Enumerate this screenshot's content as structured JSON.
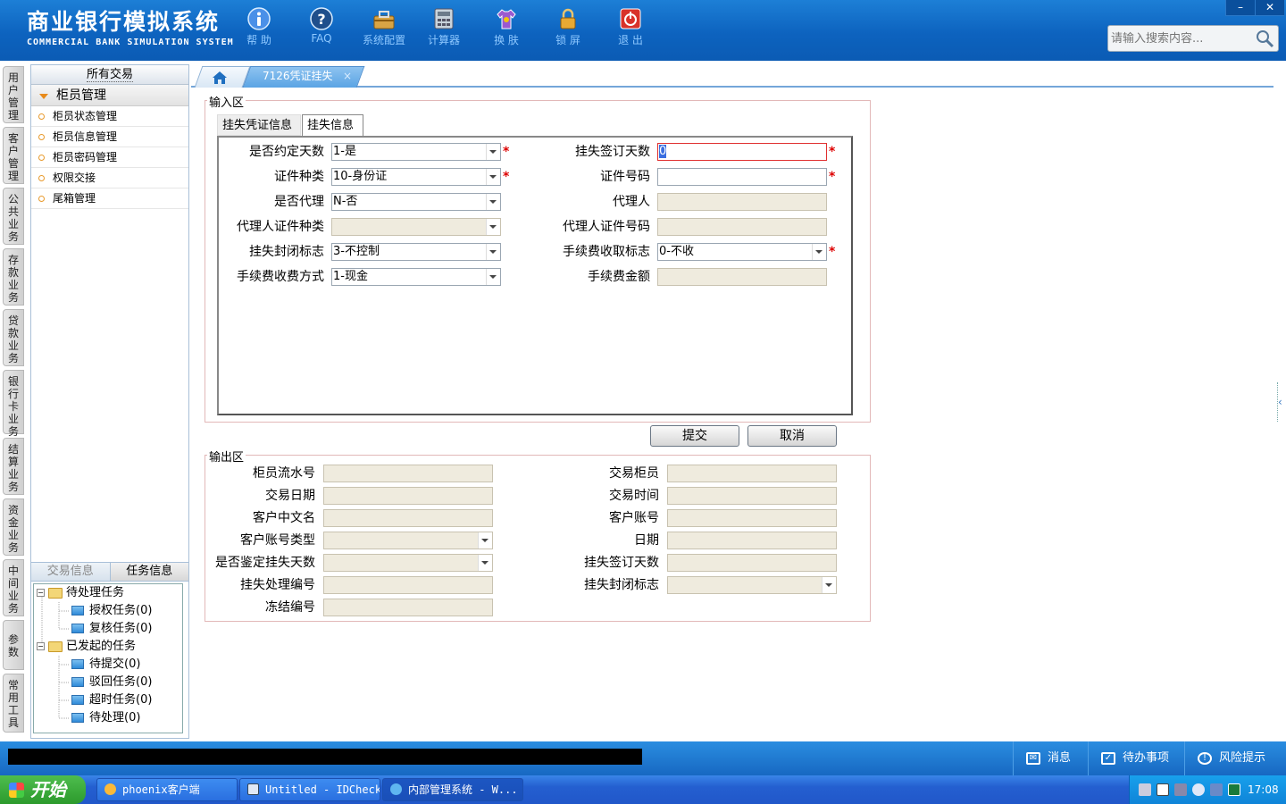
{
  "app": {
    "title_cn": "商业银行模拟系统",
    "title_en": "COMMERCIAL BANK SIMULATION SYSTEM",
    "toolbar": [
      {
        "label": "帮 助",
        "icon": "help-info-icon"
      },
      {
        "label": "FAQ",
        "icon": "faq-question-icon"
      },
      {
        "label": "系统配置",
        "icon": "toolbox-icon"
      },
      {
        "label": "计算器",
        "icon": "calculator-icon"
      },
      {
        "label": "换 肤",
        "icon": "shirt-icon"
      },
      {
        "label": "锁 屏",
        "icon": "lock-icon"
      },
      {
        "label": "退 出",
        "icon": "power-icon"
      }
    ],
    "window_minimize": "–",
    "window_close": "✕",
    "search_placeholder": "请输入搜索内容..."
  },
  "vtabs": [
    "用户管理",
    "客户管理",
    "公共业务",
    "存款业务",
    "贷款业务",
    "银行卡业务",
    "结算业务",
    "资金业务",
    "中间业务",
    "参数",
    "常用工具"
  ],
  "sidebar": {
    "header": "所有交易",
    "group": "柜员管理",
    "items": [
      "柜员状态管理",
      "柜员信息管理",
      "柜员密码管理",
      "权限交接",
      "尾箱管理"
    ],
    "bottom_tabs": [
      "交易信息",
      "任务信息"
    ],
    "tree": {
      "pending_root": "待处理任务",
      "pending_children": [
        "授权任务(0)",
        "复核任务(0)"
      ],
      "initiated_root": "已发起的任务",
      "initiated_children": [
        "待提交(0)",
        "驳回任务(0)",
        "超时任务(0)",
        "待处理(0)"
      ]
    }
  },
  "main_tab": {
    "label": "7126凭证挂失",
    "close": "×"
  },
  "input_area": {
    "legend": "输入区",
    "tabs": [
      "挂失凭证信息",
      "挂失信息"
    ],
    "fields": {
      "agreed_days_label": "是否约定天数",
      "agreed_days_value": "1-是",
      "signed_days_label": "挂失签订天数",
      "signed_days_value": "0",
      "id_type_label": "证件种类",
      "id_type_value": "10-身份证",
      "id_no_label": "证件号码",
      "id_no_value": "",
      "is_agent_label": "是否代理",
      "is_agent_value": "N-否",
      "agent_label": "代理人",
      "agent_value": "",
      "agent_id_type_label": "代理人证件种类",
      "agent_id_type_value": "",
      "agent_id_no_label": "代理人证件号码",
      "agent_id_no_value": "",
      "seal_flag_label": "挂失封闭标志",
      "seal_flag_value": "3-不控制",
      "fee_flag_label": "手续费收取标志",
      "fee_flag_value": "0-不收",
      "fee_method_label": "手续费收费方式",
      "fee_method_value": "1-现金",
      "fee_amount_label": "手续费金额",
      "fee_amount_value": ""
    },
    "required_mark": "*",
    "submit": "提交",
    "cancel": "取消"
  },
  "output_area": {
    "legend": "输出区",
    "fields": {
      "teller_seq": "柜员流水号",
      "trade_teller": "交易柜员",
      "trade_date": "交易日期",
      "trade_time": "交易时间",
      "cust_name": "客户中文名",
      "cust_account": "客户账号",
      "account_type": "客户账号类型",
      "date": "日期",
      "verify_days": "是否鉴定挂失天数",
      "signed_days": "挂失签订天数",
      "loss_no": "挂失处理编号",
      "seal_flag": "挂失封闭标志",
      "freeze_no": "冻结编号"
    }
  },
  "statusbar": {
    "messages": "消息",
    "todo": "待办事项",
    "risk": "风险提示"
  },
  "taskbar": {
    "start": "开始",
    "tasks": [
      "phoenix客户端",
      "Untitled - IDCheck",
      "内部管理系统 - W..."
    ],
    "clock": "17:08"
  },
  "colors": {
    "header": "#0d63bf",
    "required": "#dd0000",
    "readonly": "#efebde"
  }
}
